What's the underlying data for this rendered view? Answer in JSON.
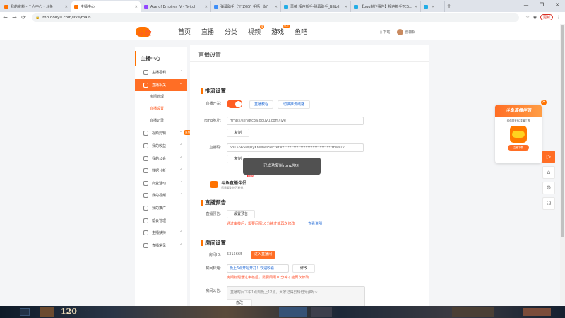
{
  "browser": {
    "tabs": [
      {
        "label": "我的资料 - 个人中心 - 斗鱼",
        "favicon_color": "#ff7200",
        "active": false
      },
      {
        "label": "主播中心",
        "favicon_color": "#ff7200",
        "active": true
      },
      {
        "label": "Age of Empires IV - Twitch",
        "favicon_color": "#9146ff",
        "active": false
      },
      {
        "label": "弹幕助手（\"[\"ZGS\" 手柄一站\"",
        "favicon_color": "#3e8ef7",
        "active": false
      },
      {
        "label": "蔷薇 相声新手-弹幕助手_Bilibili",
        "favicon_color": "#23ade5",
        "active": false
      },
      {
        "label": "【bug制作事件】相声新手TCS...",
        "favicon_color": "#23ade5",
        "active": false
      },
      {
        "label": "",
        "favicon_color": "#23ade5",
        "active": false
      }
    ],
    "new_tab": "+",
    "window_controls": [
      "—",
      "❐",
      "✕"
    ],
    "url": "mp.douyu.com/live/main",
    "update_button": "更新",
    "nav_icons": [
      "←",
      "→",
      "⟳"
    ]
  },
  "site": {
    "logo_text": "斗鱼",
    "menu": [
      {
        "label": "首页",
        "badge": "",
        "badge_type": ""
      },
      {
        "label": "直播",
        "badge": "",
        "badge_type": ""
      },
      {
        "label": "分类",
        "badge": "",
        "badge_type": ""
      },
      {
        "label": "视频",
        "badge": "4",
        "badge_type": "dot"
      },
      {
        "label": "游戏",
        "badge": "HOT",
        "badge_type": "new"
      },
      {
        "label": "鱼吧",
        "badge": "",
        "badge_type": ""
      }
    ],
    "download_label": "下载",
    "username": "蔷薇相"
  },
  "sidebar": {
    "title": "主播中心",
    "items": [
      {
        "label": "主播福利",
        "chevron": "⌃",
        "active": false,
        "tag": ""
      },
      {
        "label": "直播相关",
        "chevron": "⌃",
        "active": true,
        "tag": ""
      },
      {
        "label": "房间管理",
        "sub": true,
        "current": false
      },
      {
        "label": "直播设置",
        "sub": true,
        "current": true
      },
      {
        "label": "直播记录",
        "sub": true,
        "current": false
      },
      {
        "label": "视频剪辑",
        "chevron": "⌃",
        "active": false,
        "tag": "直播"
      },
      {
        "label": "我的收益",
        "chevron": "⌃",
        "active": false,
        "tag": ""
      },
      {
        "label": "我的公会",
        "chevron": "⌃",
        "active": false,
        "tag": ""
      },
      {
        "label": "数据分析",
        "chevron": "⌃",
        "active": false,
        "tag": ""
      },
      {
        "label": "商业活动",
        "chevron": "⌃",
        "active": false,
        "tag": ""
      },
      {
        "label": "我的视频",
        "chevron": "⌃",
        "active": false,
        "tag": ""
      },
      {
        "label": "我的推广",
        "chevron": "",
        "active": false,
        "tag": ""
      },
      {
        "label": "帮会管理",
        "chevron": "",
        "active": false,
        "tag": ""
      },
      {
        "label": "主播扶持",
        "chevron": "⌃",
        "active": false,
        "tag": ""
      },
      {
        "label": "直播常见",
        "chevron": "⌃",
        "active": false,
        "tag": ""
      }
    ]
  },
  "main": {
    "page_title": "直播设置",
    "stream": {
      "section_title": "推流设置",
      "switch_label": "直播开关:",
      "switch_on": true,
      "link1": "直播教程",
      "link2": "切换推流线路",
      "rtmp_label": "rtmp地址:",
      "rtmp_value": "rtmp://sendtc3a.douyu.com/live",
      "copy_label": "复制",
      "code_label": "直播码:",
      "code_value": "5315665reJUyKnwhesSecret=****************************fbwsTv",
      "copy_label2": "复制"
    },
    "promo": {
      "title": "斗鱼直播伴侣",
      "subtitle": "您需要100万粉丝",
      "tag": "NEW"
    },
    "toast": "已成功复制rtmp地址",
    "preview": {
      "section_title": "直播预告",
      "label": "直播预告:",
      "button": "设置预告",
      "notice": "通过审核后，需要间隔10分钟才能再次修改",
      "link": "查看说明"
    },
    "room": {
      "section_title": "房间设置",
      "id_label": "房间ID:",
      "id_value": "5315665",
      "enter_button": "进入直播间",
      "title_label": "房间标题:",
      "title_value": "晚上6点开始开打！欢迎收看！",
      "edit_button": "修改",
      "title_notice": "房间标题通过审核后，需要间隔10分钟才能再次修改",
      "announce_label": "房间公告:",
      "announce_value": "直播时间下午1点到晚上12点，大家记得剪辑但光弹呀~",
      "edit_button2": "修改"
    }
  },
  "float_card": {
    "title": "斗鱼直播伴侣",
    "subtitle": "给你带来PC直播工具",
    "button": "立即下载",
    "close": "✕"
  },
  "side_tools": [
    "▷",
    "⌂",
    "⚙",
    "☊"
  ],
  "bottom": {
    "number": "120",
    "wifi_icon": "⌔"
  },
  "colors": {
    "accent": "#ff6e25",
    "link": "#2f73d8",
    "warning": "#ff4b25"
  }
}
